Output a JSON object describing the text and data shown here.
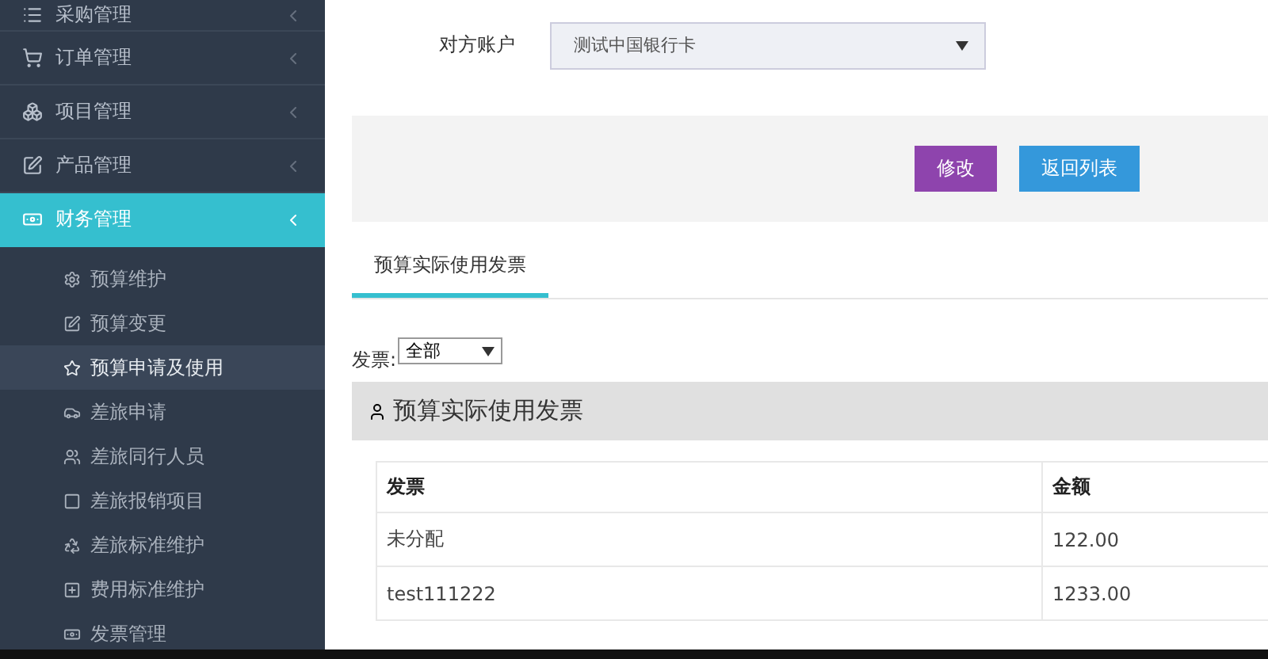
{
  "sidebar": {
    "items": [
      {
        "label": "采购管理",
        "expanded": false,
        "selected": false
      },
      {
        "label": "订单管理",
        "expanded": false,
        "selected": false
      },
      {
        "label": "项目管理",
        "expanded": false,
        "selected": false
      },
      {
        "label": "产品管理",
        "expanded": false,
        "selected": false
      },
      {
        "label": "财务管理",
        "expanded": true,
        "selected": true,
        "children": [
          {
            "label": "预算维护",
            "selected": false
          },
          {
            "label": "预算变更",
            "selected": false
          },
          {
            "label": "预算申请及使用",
            "selected": true
          },
          {
            "label": "差旅申请",
            "selected": false
          },
          {
            "label": "差旅同行人员",
            "selected": false
          },
          {
            "label": "差旅报销项目",
            "selected": false
          },
          {
            "label": "差旅标准维护",
            "selected": false
          },
          {
            "label": "费用标准维护",
            "selected": false
          },
          {
            "label": "发票管理",
            "selected": false
          }
        ]
      }
    ]
  },
  "form": {
    "label": "对方账户",
    "value": "测试中国银行卡"
  },
  "actions": [
    {
      "label": "修改",
      "kind": "edit"
    },
    {
      "label": "返回列表",
      "kind": "back"
    }
  ],
  "tabs": [
    {
      "label": "预算实际使用发票",
      "selected": true
    }
  ],
  "filter": {
    "label": "发票:",
    "value": "全部"
  },
  "section": {
    "title": "预算实际使用发票"
  },
  "table": {
    "columns": [
      "发票",
      "金额"
    ],
    "rows": [
      [
        "未分配",
        "122.00"
      ],
      [
        "test111222",
        "1233.00"
      ]
    ]
  }
}
